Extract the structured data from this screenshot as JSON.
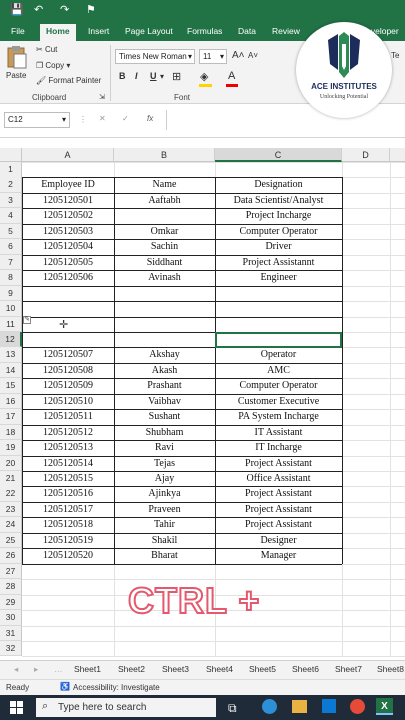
{
  "titlebar": {
    "undo": "↶",
    "redo": "↷",
    "save": "💾",
    "share": "⚑"
  },
  "ribbon_tabs": [
    "File",
    "Home",
    "Insert",
    "Page Layout",
    "Formulas",
    "Data",
    "Review",
    "Developer"
  ],
  "active_tab": "Home",
  "clipboard": {
    "paste": "Paste",
    "cut": "Cut",
    "copy": "Copy",
    "format_painter": "Format Painter",
    "group": "Clipboard"
  },
  "font": {
    "name": "Times New Roman",
    "size": "11",
    "group": "Font",
    "bold": "B",
    "italic": "I",
    "underline": "U",
    "grow": "A",
    "shrink": "A"
  },
  "right_ribbon": {
    "text": "Te"
  },
  "formula_bar": {
    "name_box": "C12",
    "cancel": "✕",
    "enter": "✓",
    "fx": "fx",
    "content": ""
  },
  "columns": [
    "A",
    "B",
    "C",
    "D"
  ],
  "headers": {
    "a": "Employee ID",
    "b": "Name",
    "c": "Designation"
  },
  "rows": [
    {
      "r": "1",
      "a": "",
      "b": "",
      "c": ""
    },
    {
      "r": "2",
      "a": "Employee ID",
      "b": "Name",
      "c": "Designation"
    },
    {
      "r": "3",
      "a": "1205120501",
      "b": "Aaftabh",
      "c": "Data Scientist/Analyst"
    },
    {
      "r": "4",
      "a": "1205120502",
      "b": "",
      "c": "Project Incharge"
    },
    {
      "r": "5",
      "a": "1205120503",
      "b": "Omkar",
      "c": "Computer Operator"
    },
    {
      "r": "6",
      "a": "1205120504",
      "b": "Sachin",
      "c": "Driver"
    },
    {
      "r": "7",
      "a": "1205120505",
      "b": "Siddhant",
      "c": "Project Assistannt"
    },
    {
      "r": "8",
      "a": "1205120506",
      "b": "Avinash",
      "c": "Engineer"
    },
    {
      "r": "9",
      "a": "",
      "b": "",
      "c": ""
    },
    {
      "r": "10",
      "a": "",
      "b": "",
      "c": ""
    },
    {
      "r": "11",
      "a": "",
      "b": "",
      "c": ""
    },
    {
      "r": "12",
      "a": "",
      "b": "",
      "c": ""
    },
    {
      "r": "13",
      "a": "1205120507",
      "b": "Akshay",
      "c": "Operator"
    },
    {
      "r": "14",
      "a": "1205120508",
      "b": "Akash",
      "c": "AMC"
    },
    {
      "r": "15",
      "a": "1205120509",
      "b": "Prashant",
      "c": "Computer Operator"
    },
    {
      "r": "16",
      "a": "1205120510",
      "b": "Vaibhav",
      "c": "Customer Executive"
    },
    {
      "r": "17",
      "a": "1205120511",
      "b": "Sushant",
      "c": "PA System Incharge"
    },
    {
      "r": "18",
      "a": "1205120512",
      "b": "Shubham",
      "c": "IT Assistant"
    },
    {
      "r": "19",
      "a": "1205120513",
      "b": "Ravi",
      "c": "IT Incharge"
    },
    {
      "r": "20",
      "a": "1205120514",
      "b": "Tejas",
      "c": "Project Assistant"
    },
    {
      "r": "21",
      "a": "1205120515",
      "b": "Ajay",
      "c": "Office Assistant"
    },
    {
      "r": "22",
      "a": "1205120516",
      "b": "Ajinkya",
      "c": "Project Assistant"
    },
    {
      "r": "23",
      "a": "1205120517",
      "b": "Praveen",
      "c": "Project Assistant"
    },
    {
      "r": "24",
      "a": "1205120518",
      "b": "Tahir",
      "c": "Project Assistant"
    },
    {
      "r": "25",
      "a": "1205120519",
      "b": "Shakil",
      "c": "Designer"
    },
    {
      "r": "26",
      "a": "1205120520",
      "b": "Bharat",
      "c": "Manager"
    },
    {
      "r": "27",
      "a": "",
      "b": "",
      "c": ""
    },
    {
      "r": "28",
      "a": "",
      "b": "",
      "c": ""
    },
    {
      "r": "29",
      "a": "",
      "b": "",
      "c": ""
    },
    {
      "r": "30",
      "a": "",
      "b": "",
      "c": ""
    },
    {
      "r": "31",
      "a": "",
      "b": "",
      "c": ""
    },
    {
      "r": "32",
      "a": "",
      "b": "",
      "c": ""
    }
  ],
  "sheets": [
    "Sheet1",
    "Sheet2",
    "Sheet3",
    "Sheet4",
    "Sheet5",
    "Sheet6",
    "Sheet7",
    "Sheet8"
  ],
  "status": {
    "ready": "Ready",
    "accessibility": "Accessibility: Investigate"
  },
  "taskbar": {
    "search": "Type here to search"
  },
  "logo": {
    "brand": "ACE INSTITUTES",
    "tagline": "Unlocking Potential"
  },
  "overlay": "CTRL +",
  "colors": {
    "excel_green": "#217346",
    "overlay_stroke": "#e35a6f",
    "logo_navy": "#1c2d5c",
    "logo_green": "#2e8b57"
  }
}
